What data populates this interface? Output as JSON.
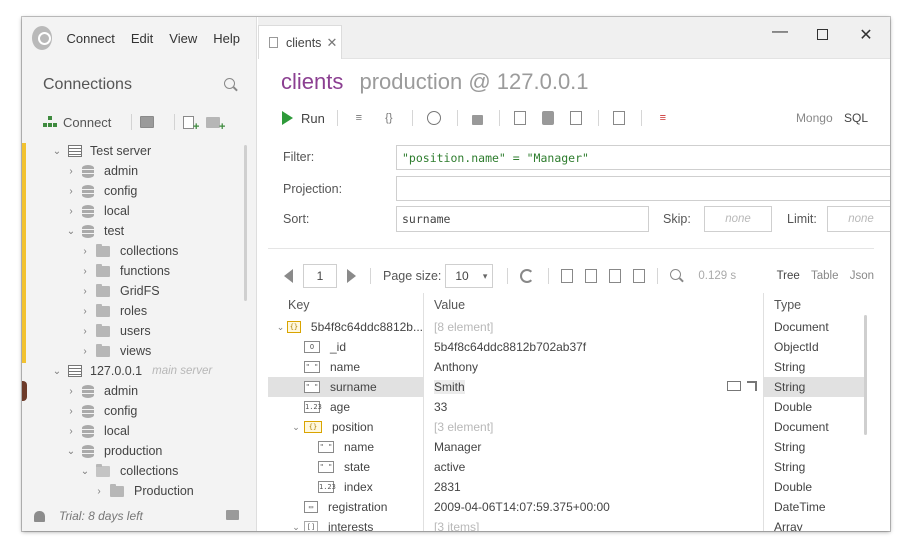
{
  "menu": [
    "Connect",
    "Edit",
    "View",
    "Help"
  ],
  "connections": {
    "title": "Connections",
    "connect_label": "Connect"
  },
  "tree": [
    {
      "label": "Test server",
      "kind": "server",
      "level": 0,
      "expanded": true
    },
    {
      "label": "admin",
      "kind": "db",
      "level": 1
    },
    {
      "label": "config",
      "kind": "db",
      "level": 1
    },
    {
      "label": "local",
      "kind": "db",
      "level": 1
    },
    {
      "label": "test",
      "kind": "db",
      "level": 1,
      "expanded": true
    },
    {
      "label": "collections",
      "kind": "folder",
      "level": 2
    },
    {
      "label": "functions",
      "kind": "folder",
      "level": 2
    },
    {
      "label": "GridFS",
      "kind": "folder",
      "level": 2
    },
    {
      "label": "roles",
      "kind": "folder",
      "level": 2
    },
    {
      "label": "users",
      "kind": "folder",
      "level": 2
    },
    {
      "label": "views",
      "kind": "folder",
      "level": 2
    },
    {
      "label": "127.0.0.1",
      "kind": "server",
      "level": 0,
      "expanded": true,
      "hint": "main server"
    },
    {
      "label": "admin",
      "kind": "db",
      "level": 1
    },
    {
      "label": "config",
      "kind": "db",
      "level": 1
    },
    {
      "label": "local",
      "kind": "db",
      "level": 1
    },
    {
      "label": "production",
      "kind": "db",
      "level": 1,
      "expanded": true
    },
    {
      "label": "collections",
      "kind": "folder",
      "level": 2,
      "expanded": true
    },
    {
      "label": "Production",
      "kind": "folder",
      "level": 3
    }
  ],
  "trial": "Trial: 8 days left",
  "tab": {
    "label": "clients"
  },
  "title": {
    "collection": "clients",
    "server": "production @ 127.0.0.1"
  },
  "toolbar": {
    "run": "Run",
    "mongo": "Mongo",
    "sql": "SQL"
  },
  "query": {
    "filter_label": "Filter:",
    "filter_value": "\"position.name\" = \"Manager\"",
    "projection_label": "Projection:",
    "projection_value": "",
    "sort_label": "Sort:",
    "sort_value": "surname",
    "skip_label": "Skip:",
    "skip_placeholder": "none",
    "limit_label": "Limit:",
    "limit_placeholder": "none"
  },
  "pager": {
    "page": "1",
    "page_size_label": "Page size:",
    "page_size": "10",
    "timing": "0.129 s",
    "views": [
      "Tree",
      "Table",
      "Json"
    ],
    "active_view": "Tree"
  },
  "grid": {
    "headers": {
      "key": "Key",
      "value": "Value",
      "type": "Type"
    },
    "rows": [
      {
        "key": "5b4f8c64ddc8812b...",
        "value": "[8 element]",
        "type": "Document",
        "icon": "obj",
        "indent": 0,
        "chev": "▾",
        "muted": true
      },
      {
        "key": "_id",
        "value": "5b4f8c64ddc8812b702ab37f",
        "type": "ObjectId",
        "icon": "oid",
        "indent": 1
      },
      {
        "key": "name",
        "value": "Anthony",
        "type": "String",
        "icon": "str",
        "indent": 1
      },
      {
        "key": "surname",
        "value": "Smith",
        "type": "String",
        "icon": "str",
        "indent": 1,
        "selected": true
      },
      {
        "key": "age",
        "value": "33",
        "type": "Double",
        "icon": "num",
        "indent": 1
      },
      {
        "key": "position",
        "value": "[3 element]",
        "type": "Document",
        "icon": "obj",
        "indent": 1,
        "chev": "▾",
        "muted": true
      },
      {
        "key": "name",
        "value": "Manager",
        "type": "String",
        "icon": "str",
        "indent": 2
      },
      {
        "key": "state",
        "value": "active",
        "type": "String",
        "icon": "str",
        "indent": 2
      },
      {
        "key": "index",
        "value": "2831",
        "type": "Double",
        "icon": "num",
        "indent": 2
      },
      {
        "key": "registration",
        "value": "2009-04-06T14:07:59.375+00:00",
        "type": "DateTime",
        "icon": "date",
        "indent": 1
      },
      {
        "key": "interests",
        "value": "[3 items]",
        "type": "Array",
        "icon": "arr",
        "indent": 1,
        "chev": "▾",
        "muted": true
      }
    ]
  }
}
